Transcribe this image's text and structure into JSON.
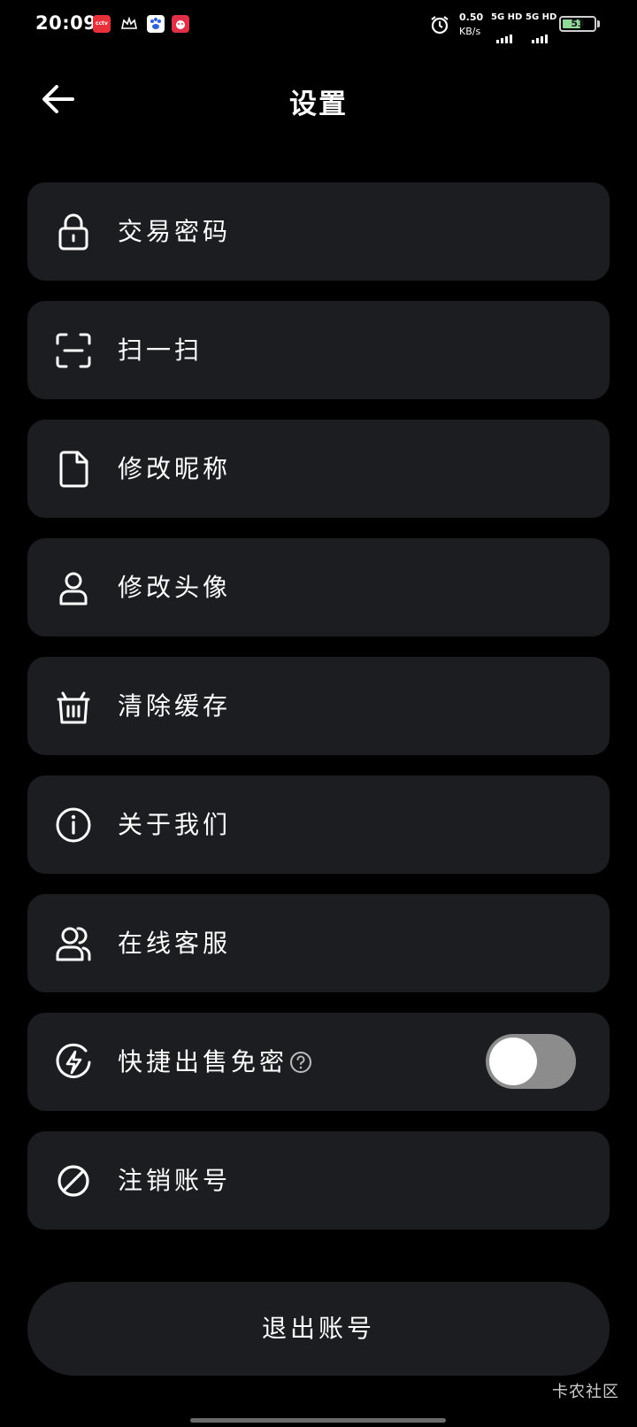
{
  "status_bar": {
    "time": "20:09",
    "net_speed_value": "0.50",
    "net_speed_unit": "KB/s",
    "signal_1": "5G HD",
    "signal_2": "5G HD",
    "battery": "53",
    "notif_1_label": "cctv"
  },
  "header": {
    "title": "设置"
  },
  "settings": {
    "items": [
      {
        "label": "交易密码",
        "icon": "lock-icon"
      },
      {
        "label": "扫一扫",
        "icon": "scan-icon"
      },
      {
        "label": "修改昵称",
        "icon": "document-icon"
      },
      {
        "label": "修改头像",
        "icon": "user-icon"
      },
      {
        "label": "清除缓存",
        "icon": "basket-icon"
      },
      {
        "label": "关于我们",
        "icon": "info-icon"
      },
      {
        "label": "在线客服",
        "icon": "support-icon"
      },
      {
        "label": "快捷出售免密",
        "icon": "flash-icon",
        "toggle": false
      },
      {
        "label": "注销账号",
        "icon": "ban-icon"
      }
    ]
  },
  "logout": {
    "label": "退出账号"
  },
  "watermark": "卡农社区",
  "colors": {
    "background": "#000000",
    "card": "#1c1d20",
    "toggle_off": "#8c8c8c",
    "battery_fill": "#8fd89a"
  }
}
